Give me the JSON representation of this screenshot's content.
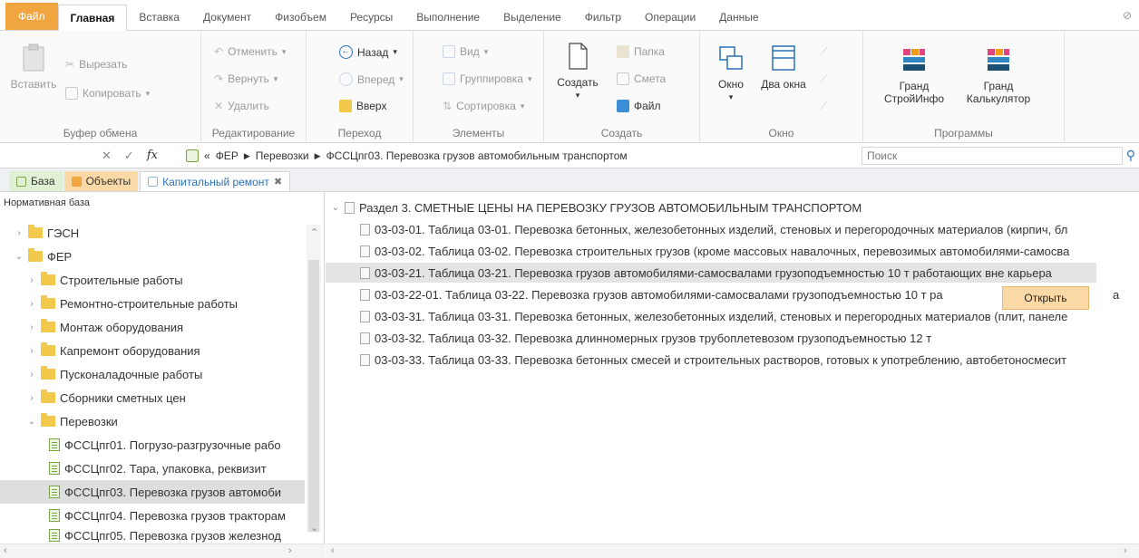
{
  "ribbon_tabs": [
    {
      "label": "Файл"
    },
    {
      "label": "Главная"
    },
    {
      "label": "Вставка"
    },
    {
      "label": "Документ"
    },
    {
      "label": "Физобъем"
    },
    {
      "label": "Ресурсы"
    },
    {
      "label": "Выполнение"
    },
    {
      "label": "Выделение"
    },
    {
      "label": "Фильтр"
    },
    {
      "label": "Операции"
    },
    {
      "label": "Данные"
    }
  ],
  "groups": {
    "clipboard": {
      "title": "Буфер обмена",
      "paste": "Вставить",
      "cut": "Вырезать",
      "copy": "Копировать"
    },
    "editing": {
      "title": "Редактирование",
      "undo": "Отменить",
      "redo": "Вернуть",
      "delete": "Удалить"
    },
    "navigation": {
      "title": "Переход",
      "back": "Назад",
      "forward": "Вперед",
      "up": "Вверх"
    },
    "elements": {
      "title": "Элементы",
      "view": "Вид",
      "grouping": "Группировка",
      "sorting": "Сортировка"
    },
    "create": {
      "title": "Создать",
      "create": "Создать",
      "folder": "Папка",
      "estimate": "Смета",
      "file": "Файл"
    },
    "window": {
      "title": "Окно",
      "window": "Окно",
      "two_windows": "Два окна"
    },
    "programs": {
      "title": "Программы",
      "grand_stroyinfo": "Гранд СтройИнфо",
      "grand_calculator": "Гранд Калькулятор"
    }
  },
  "path": {
    "separator": "«",
    "parts": [
      "ФЕР",
      "Перевозки",
      "ФССЦпг03. Перевозка грузов автомобильным транспортом"
    ],
    "search_placeholder": "Поиск"
  },
  "doc_tabs": [
    "База",
    "Объекты",
    "Капитальный ремонт"
  ],
  "left_panel": {
    "title": "Нормативная база",
    "tree": [
      {
        "label": "ГЭСН",
        "level": 0,
        "expanded": false,
        "kind": "folder"
      },
      {
        "label": "ФЕР",
        "level": 0,
        "expanded": true,
        "kind": "folder"
      },
      {
        "label": "Строительные работы",
        "level": 1,
        "expanded": false,
        "kind": "folder"
      },
      {
        "label": "Ремонтно-строительные работы",
        "level": 1,
        "expanded": false,
        "kind": "folder"
      },
      {
        "label": "Монтаж оборудования",
        "level": 1,
        "expanded": false,
        "kind": "folder"
      },
      {
        "label": "Капремонт оборудования",
        "level": 1,
        "expanded": false,
        "kind": "folder"
      },
      {
        "label": "Пусконаладочные работы",
        "level": 1,
        "expanded": false,
        "kind": "folder"
      },
      {
        "label": "Сборники сметных цен",
        "level": 1,
        "expanded": false,
        "kind": "folder"
      },
      {
        "label": "Перевозки",
        "level": 1,
        "expanded": true,
        "kind": "folder"
      },
      {
        "label": "ФССЦпг01. Погрузо-разгрузочные рабо",
        "level": 2,
        "kind": "doc"
      },
      {
        "label": "ФССЦпг02. Тара, упаковка, реквизит",
        "level": 2,
        "kind": "doc"
      },
      {
        "label": "ФССЦпг03. Перевозка грузов автомоби",
        "level": 2,
        "kind": "doc",
        "selected": true
      },
      {
        "label": "ФССЦпг04. Перевозка грузов тракторам",
        "level": 2,
        "kind": "doc"
      },
      {
        "label": "ФССЦпг05. Перевозка грузов железнод",
        "level": 2,
        "kind": "doc"
      }
    ]
  },
  "right_panel": {
    "section": "Раздел 3. СМЕТНЫЕ ЦЕНЫ НА ПЕРЕВОЗКУ ГРУЗОВ АВТОМОБИЛЬНЫМ ТРАНСПОРТОМ",
    "rows": [
      {
        "text": "03-03-01. Таблица 03-01. Перевозка бетонных, железобетонных изделий, стеновых и перегородочных материалов (кирпич, бл"
      },
      {
        "text": "03-03-02. Таблица 03-02. Перевозка строительных грузов (кроме массовых навалочных, перевозимых автомобилями-самосва"
      },
      {
        "text": "03-03-21. Таблица 03-21. Перевозка грузов автомобилями-самосвалами грузоподъемностью 10 т работающих вне карьера",
        "selected": true
      },
      {
        "text": "03-03-22-01. Таблица 03-22. Перевозка грузов автомобилями-самосвалами грузоподъемностью 10 т ра"
      },
      {
        "text": "03-03-31. Таблица 03-31. Перевозка бетонных, железобетонных изделий, стеновых и перегородных материалов (плит, панеле"
      },
      {
        "text": "03-03-32. Таблица 03-32. Перевозка длинномерных грузов трубоплетевозом грузоподъемностью 12 т"
      },
      {
        "text": "03-03-33. Таблица 03-33. Перевозка бетонных смесей и строительных растворов, готовых к употреблению, автобетоносмесит"
      }
    ],
    "context_action": "Открыть",
    "truncated_tail": "а"
  }
}
